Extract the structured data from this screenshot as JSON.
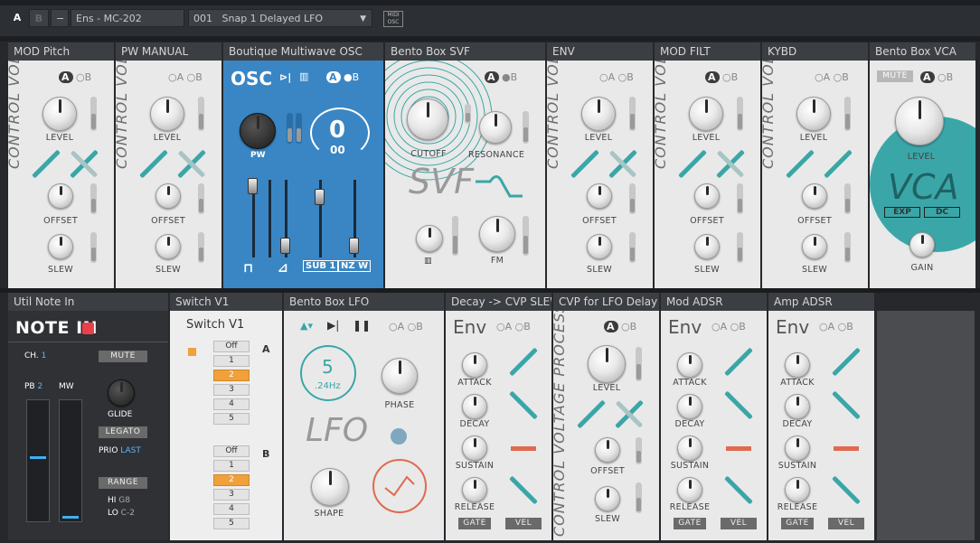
{
  "toolbar": {
    "a": "A",
    "b": "B",
    "minus": "−",
    "ensemble": "Ens - MC-202",
    "preset_num": "001",
    "preset_name": "Snap 1 Delayed LFO",
    "midi": "MIDI",
    "osc": "OSC"
  },
  "ab": {
    "a": "A",
    "b": "B"
  },
  "cvp_label": "CONTROL VOLTAGE PROCESSOR",
  "labels": {
    "level": "LEVEL",
    "offset": "OFFSET",
    "slew": "SLEW",
    "cutoff": "CUTOFF",
    "resonance": "RESONANCE",
    "fm": "FM",
    "gain": "GAIN",
    "pw": "PW",
    "attack": "ATTACK",
    "decay": "DECAY",
    "sustain": "SUSTAIN",
    "release": "RELEASE",
    "gate": "GATE",
    "vel": "VEL",
    "phase": "PHASE",
    "shape": "SHAPE",
    "exp": "EXP",
    "dc": "DC",
    "mute": "MUTE",
    "sub1": "SUB 1",
    "nzw": "NZ W"
  },
  "top_devices": [
    "MOD Pitch",
    "PW MANUAL",
    "Boutique Multiwave OSC",
    "Bento Box SVF",
    "ENV",
    "MOD FILT",
    "KYBD",
    "Bento Box VCA"
  ],
  "bottom_devices": [
    "Util Note In",
    "Switch V1",
    "Bento Box LFO",
    "Decay -> CVP SLEW",
    "CVP for LFO Delay",
    "Mod ADSR",
    "Amp ADSR"
  ],
  "osc": {
    "title": "OSC",
    "value": "0",
    "sub": "00"
  },
  "svf": {
    "title": "SVF"
  },
  "vca": {
    "title": "VCA"
  },
  "lfo": {
    "title": "LFO",
    "rate": "5",
    ".rate_unit": ".24Hz"
  },
  "env_title": "Env",
  "note_in": {
    "title": "NOTE IN",
    "ch_label": "CH.",
    "ch": "1",
    "pb_label": "PB",
    "pb": "2",
    "mw": "MW",
    "mute": "MUTE",
    "glide": "GLIDE",
    "legato": "LEGATO",
    "prio_label": "PRIO",
    "prio": "LAST",
    "range": "RANGE",
    "hi_label": "HI",
    "hi": "G8",
    "lo_label": "LO",
    "lo": "C-2"
  },
  "switch": {
    "title": "Switch V1",
    "a": "A",
    "b": "B",
    "options": [
      "Off",
      "1",
      "2",
      "3",
      "4",
      "5"
    ],
    "selected_a": "2",
    "selected_b": "2"
  }
}
